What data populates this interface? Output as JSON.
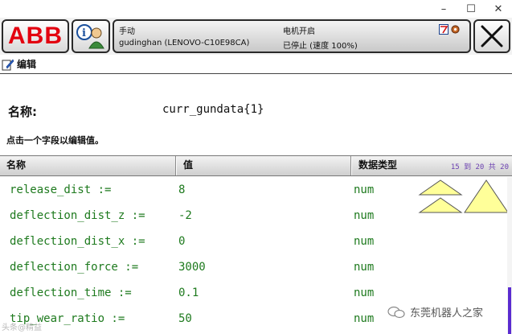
{
  "window": {
    "controls": [
      {
        "name": "minimize-button",
        "glyph": "–"
      },
      {
        "name": "maximize-button",
        "glyph": "☐"
      },
      {
        "name": "close-window-button",
        "glyph": "✕"
      }
    ]
  },
  "topbar": {
    "logo": "ABB",
    "mode": "手动",
    "controller": "gudinghan (LENOVO-C10E98CA)",
    "motor_state": "电机开启",
    "run_state": "已停止 (速度 100%)"
  },
  "editor": {
    "title": "编辑",
    "name_label": "名称:",
    "name_value": "curr_gundata{1}",
    "hint": "点击一个字段以编辑值。"
  },
  "table": {
    "headers": {
      "name": "名称",
      "value": "值",
      "type": "数据类型"
    },
    "pager": "15 到 20 共 20",
    "rows": [
      {
        "name": "release_dist :=",
        "value": "8",
        "type": "num"
      },
      {
        "name": "deflection_dist_z :=",
        "value": "-2",
        "type": "num"
      },
      {
        "name": "deflection_dist_x :=",
        "value": "0",
        "type": "num"
      },
      {
        "name": "deflection_force :=",
        "value": "3000",
        "type": "num"
      },
      {
        "name": "deflection_time :=",
        "value": "0.1",
        "type": "num"
      },
      {
        "name": "tip_wear_ratio :=",
        "value": "50",
        "type": "num"
      }
    ]
  },
  "watermark": {
    "text": "东莞机器人之家",
    "left_text": "头条@精益"
  },
  "colors": {
    "accent_red": "#e3000f",
    "value_green": "#1e7a1e",
    "pager_purple": "#6a3fb0",
    "arrow_yellow": "#ffff99"
  }
}
